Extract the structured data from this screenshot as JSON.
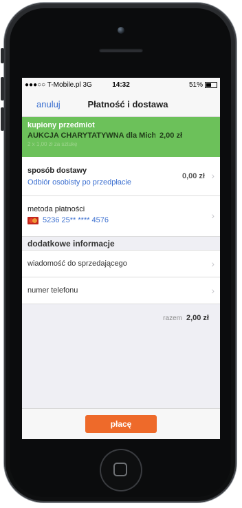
{
  "status_bar": {
    "carrier": "●●●○○ T-Mobile.pl  3G",
    "time": "14:32",
    "battery": "51%",
    "battery_level": 0.51
  },
  "nav": {
    "cancel_label": "anuluj",
    "title": "Płatność i dostawa"
  },
  "purchased": {
    "label": "kupiony przedmiot",
    "item_name": "AUKCJA CHARYTATYWNA dla Michałk...",
    "price": "2,00 zł",
    "quantity_note": "2 x 1,00 zł za sztukę"
  },
  "shipping": {
    "label": "sposób dostawy",
    "method": "Odbiór osobisty po przedpłacie",
    "price": "0,00 zł"
  },
  "payment": {
    "label": "metoda płatności",
    "card_number": "5236 25** **** 4576",
    "card_icon": "mastercard-icon"
  },
  "additional": {
    "header": "dodatkowe informacje",
    "message_label": "wiadomość do sprzedającego",
    "phone_label": "numer telefonu"
  },
  "summary": {
    "total_label": "razem",
    "total_value": "2,00 zł"
  },
  "pay_button_label": "płacę",
  "colors": {
    "accent_green": "#6cc15a",
    "link_blue": "#3b6fd0",
    "pay_orange": "#ee6a2a"
  }
}
